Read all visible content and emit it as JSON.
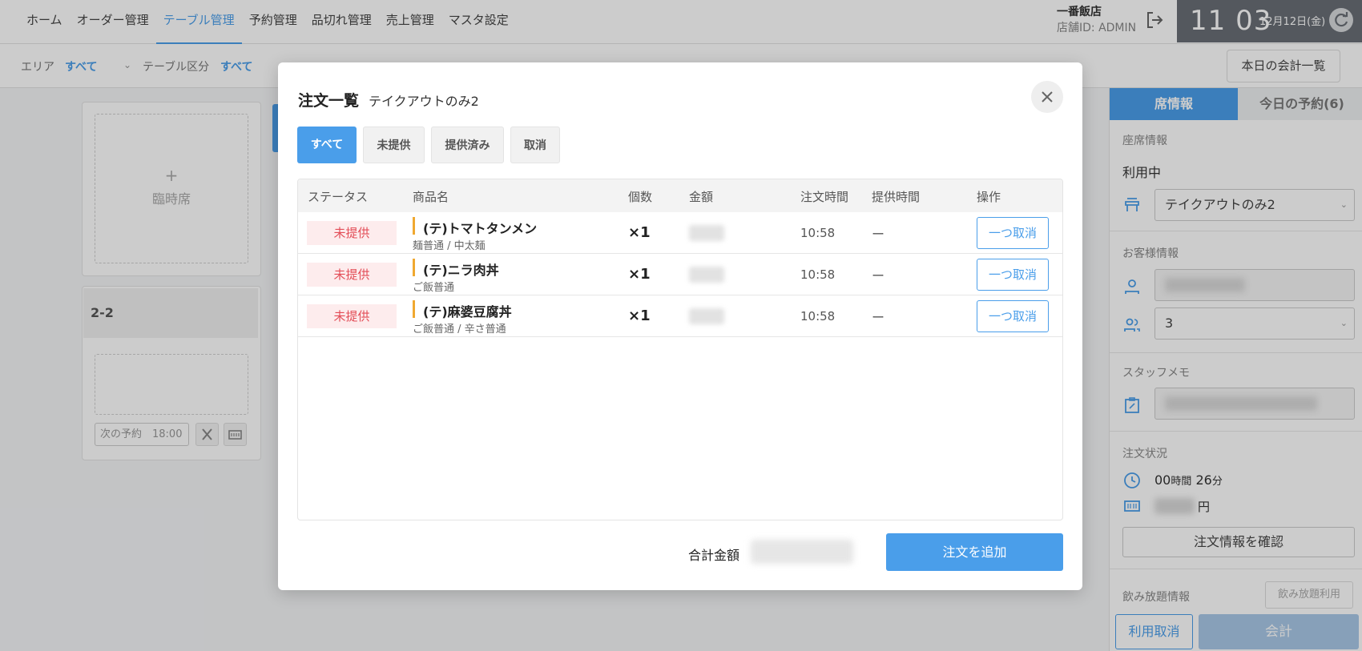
{
  "nav": {
    "items": [
      "ホーム",
      "オーダー管理",
      "テーブル管理",
      "予約管理",
      "品切れ管理",
      "売上管理",
      "マスタ設定"
    ],
    "active_index": 2
  },
  "store": {
    "name": "一番飯店",
    "id": "店舗ID: ADMIN"
  },
  "clock": {
    "time": "11 03",
    "date": "12月12日(金)"
  },
  "filters": {
    "area_label": "エリア",
    "area_value": "すべて",
    "type_label": "テーブル区分",
    "type_value": "すべて"
  },
  "daily_button": "本日の会計一覧",
  "grid": {
    "temp_plus": "+",
    "temp_label": "臨時席",
    "table_name": "2-2",
    "next_reservation": "次の予約　18:00"
  },
  "right_panel": {
    "tab_seat": "席情報",
    "tab_reservation": "今日の予約(6)",
    "seat_info_label": "座席情報",
    "seat_status": "利用中",
    "seat_select": "テイクアウトのみ2",
    "customer_label": "お客様情報",
    "guest_count": "3",
    "staff_memo_label": "スタッフメモ",
    "order_status_label": "注文状況",
    "elapsed_hours": "00",
    "hours_unit": "時間",
    "elapsed_minutes": "26",
    "minutes_unit": "分",
    "yen_unit": "円",
    "confirm_button": "注文情報を確認",
    "nomihodai_label": "飲み放題情報",
    "nomihodai_button": "飲み放題利用",
    "cancel_use": "利用取消",
    "checkout": "会計"
  },
  "modal": {
    "title": "注文一覧",
    "subtitle": "テイクアウトのみ2",
    "filters": [
      "すべて",
      "未提供",
      "提供済み",
      "取消"
    ],
    "columns": {
      "status": "ステータス",
      "product": "商品名",
      "qty": "個数",
      "amount": "金額",
      "order_time": "注文時間",
      "served_time": "提供時間",
      "action": "操作"
    },
    "rows": [
      {
        "status": "未提供",
        "name": "(テ)トマトタンメン",
        "options": "麺普通 / 中太麺",
        "qty": "×1",
        "order_time": "10:58",
        "served_time": "ー",
        "action": "一つ取消"
      },
      {
        "status": "未提供",
        "name": "(テ)ニラ肉丼",
        "options": "ご飯普通",
        "qty": "×1",
        "order_time": "10:58",
        "served_time": "ー",
        "action": "一つ取消"
      },
      {
        "status": "未提供",
        "name": "(テ)麻婆豆腐丼",
        "options": "ご飯普通 / 辛さ普通",
        "qty": "×1",
        "order_time": "10:58",
        "served_time": "ー",
        "action": "一つ取消"
      }
    ],
    "total_label": "合計金額",
    "add_order": "注文を追加"
  },
  "icons": {
    "logout": "logout-icon",
    "refresh": "refresh-icon",
    "close": "close-icon",
    "seat": "seat-icon",
    "person": "person-icon",
    "people": "people-icon",
    "memo": "memo-icon",
    "clock": "clock-icon",
    "money": "money-icon",
    "cutlery": "cutlery-icon",
    "receipt": "receipt-icon"
  },
  "colors": {
    "accent": "#4a9eea",
    "status_red": "#e34d57",
    "status_bg": "#fdeced",
    "product_bar": "#f0a830"
  }
}
